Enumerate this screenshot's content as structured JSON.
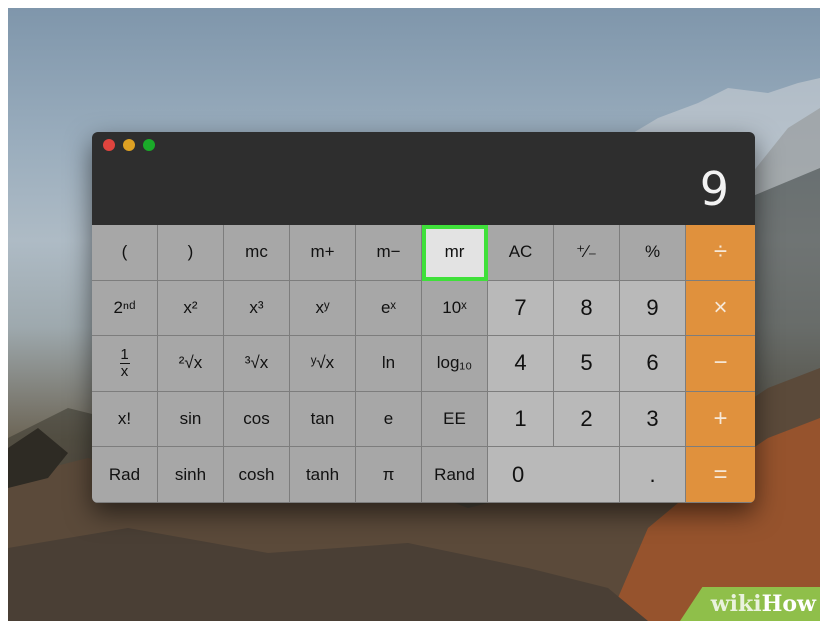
{
  "display": {
    "value": "9"
  },
  "window": {
    "buttons": [
      "close",
      "minimize",
      "zoom"
    ],
    "colors": {
      "close": "#e0443e",
      "minimize": "#dea123",
      "zoom": "#1aab29"
    }
  },
  "keys": {
    "row1": [
      "(",
      ")",
      "mc",
      "m+",
      "m−",
      "mr",
      "AC",
      "⁺∕₋",
      "%",
      "÷"
    ],
    "row2": [
      "2ⁿᵈ",
      "x²",
      "x³",
      "xʸ",
      "eˣ",
      "10ˣ",
      "7",
      "8",
      "9",
      "×"
    ],
    "row3": [
      "1",
      "x",
      "²√x",
      "³√x",
      "ʸ√x",
      "ln",
      "log₁₀",
      "4",
      "5",
      "6",
      "−"
    ],
    "row4": [
      "x!",
      "sin",
      "cos",
      "tan",
      "e",
      "EE",
      "1",
      "2",
      "3",
      "+"
    ],
    "row5": [
      "Rad",
      "sinh",
      "cosh",
      "tanh",
      "π",
      "Rand",
      "0",
      ".",
      "="
    ]
  },
  "highlight": {
    "key": "mr",
    "color": "#3fe03a"
  },
  "accent_color": "#e0913d",
  "watermark": {
    "part1": "wiki",
    "part2": "How"
  }
}
